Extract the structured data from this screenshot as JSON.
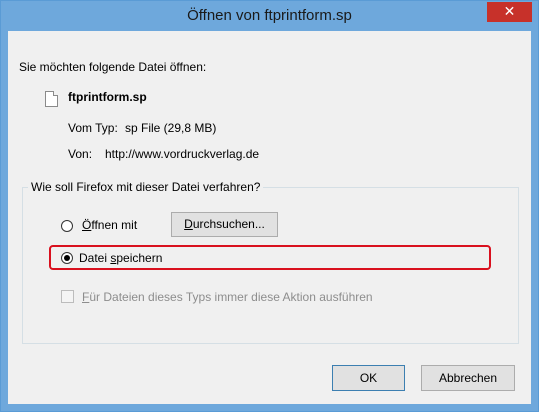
{
  "window": {
    "title": "Öffnen von ftprintform.sp",
    "close_label": "✕"
  },
  "info": {
    "prompt": "Sie möchten folgende Datei öffnen:",
    "filename": "ftprintform.sp",
    "type_label": "Vom Typ:",
    "type_value": "sp File (29,8 MB)",
    "from_label": "Von:",
    "from_value": "http://www.vordruckverlag.de"
  },
  "action_group": {
    "legend": "Wie soll Firefox mit dieser Datei verfahren?",
    "open_with": {
      "label_first": "Ö",
      "label_rest": "ffnen mit",
      "selected": false
    },
    "browse_button": {
      "label_first": "D",
      "label_rest": "urchsuchen..."
    },
    "save_file": {
      "label_start": "Datei ",
      "label_accel": "s",
      "label_rest": "peichern",
      "selected": true
    },
    "always_do": {
      "label_accel": "F",
      "label_rest": "ür Dateien dieses Typs immer diese Aktion ausführen",
      "checked": false,
      "disabled": true
    }
  },
  "buttons": {
    "ok": "OK",
    "cancel": "Abbrechen"
  },
  "colors": {
    "titlebar": "#6ea8dc",
    "close": "#c7312a",
    "highlight": "#d9101e"
  }
}
